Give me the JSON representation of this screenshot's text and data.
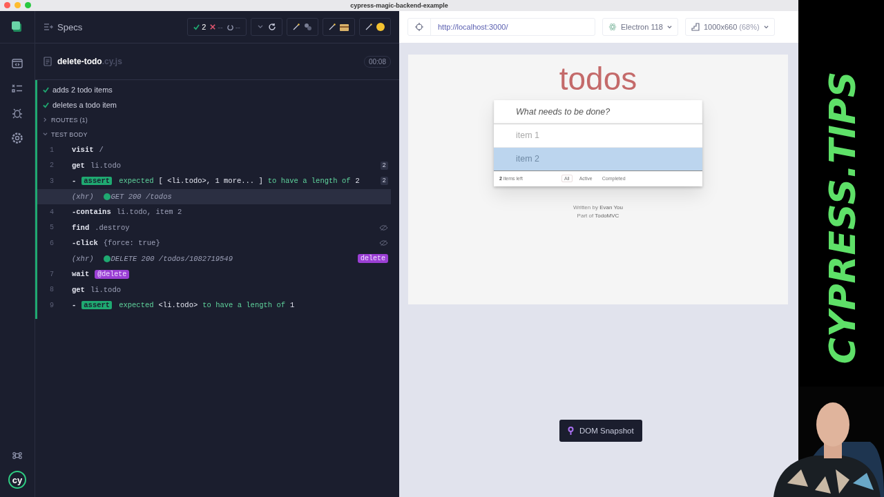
{
  "window": {
    "title": "cypress-magic-backend-example"
  },
  "sidebar": {
    "logo": "cy"
  },
  "reporter": {
    "title": "Specs",
    "stats": {
      "passed": "2",
      "failed": "--",
      "pending": "--"
    },
    "spec": {
      "name": "delete-todo",
      "extension": ".cy.js",
      "duration": "00:08"
    },
    "tests": [
      {
        "title": "adds 2 todo items",
        "passed": true
      },
      {
        "title": "deletes a todo item",
        "passed": true
      }
    ],
    "sections": [
      {
        "title": "ROUTES (1)",
        "expanded": false
      },
      {
        "title": "TEST BODY",
        "expanded": true
      }
    ],
    "commands": [
      {
        "kind": "command",
        "number": "1",
        "name": "visit",
        "message": "/"
      },
      {
        "kind": "command",
        "number": "2",
        "name": "get",
        "message": "li.todo",
        "count": "2"
      },
      {
        "kind": "assert",
        "number": "3",
        "prefix": "-",
        "name": "assert",
        "parts": [
          "expected",
          "[ <li.todo>, 1 more... ]",
          "to have a length of",
          "2"
        ],
        "count": "2"
      },
      {
        "kind": "xhr",
        "name": "(xhr)",
        "message": "GET 200 /todos",
        "hovered": true
      },
      {
        "kind": "command",
        "number": "4",
        "name": "-contains",
        "message": "li.todo, item 2"
      },
      {
        "kind": "command",
        "number": "5",
        "name": "find",
        "message": ".destroy",
        "element_hidden": true
      },
      {
        "kind": "command",
        "number": "6",
        "name": "-click",
        "message": "{force: true}",
        "element_hidden": true
      },
      {
        "kind": "xhr",
        "name": "(xhr)",
        "message": "DELETE 200 /todos/1082719549",
        "alias": "delete",
        "hovered": false
      },
      {
        "kind": "command",
        "number": "7",
        "name": "wait",
        "alias_ref": "@delete"
      },
      {
        "kind": "command",
        "number": "8",
        "name": "get",
        "message": "li.todo"
      },
      {
        "kind": "assert",
        "number": "9",
        "prefix": "-",
        "name": "assert",
        "parts": [
          "expected",
          "<li.todo>",
          "to have a length of",
          "1"
        ]
      }
    ]
  },
  "browser_bar": {
    "url": "http://localhost:3000/",
    "browser": "Electron 118",
    "viewport": "1000x660",
    "scale": "(68%)"
  },
  "app": {
    "title": "todos",
    "placeholder": "What needs to be done?",
    "items": [
      {
        "text": "item 1",
        "highlighted": false
      },
      {
        "text": "item 2",
        "highlighted": true
      }
    ],
    "count": "2",
    "count_label": "items left",
    "filters": [
      {
        "label": "All",
        "selected": true
      },
      {
        "label": "Active",
        "selected": false
      },
      {
        "label": "Completed",
        "selected": false
      }
    ],
    "info": [
      {
        "prefix": "Written by",
        "name": "Evan You"
      },
      {
        "prefix": "Part of",
        "name": "TodoMVC"
      }
    ]
  },
  "snapshot_button": "DOM Snapshot",
  "overlay_text": "CYPRESS.TIPS"
}
